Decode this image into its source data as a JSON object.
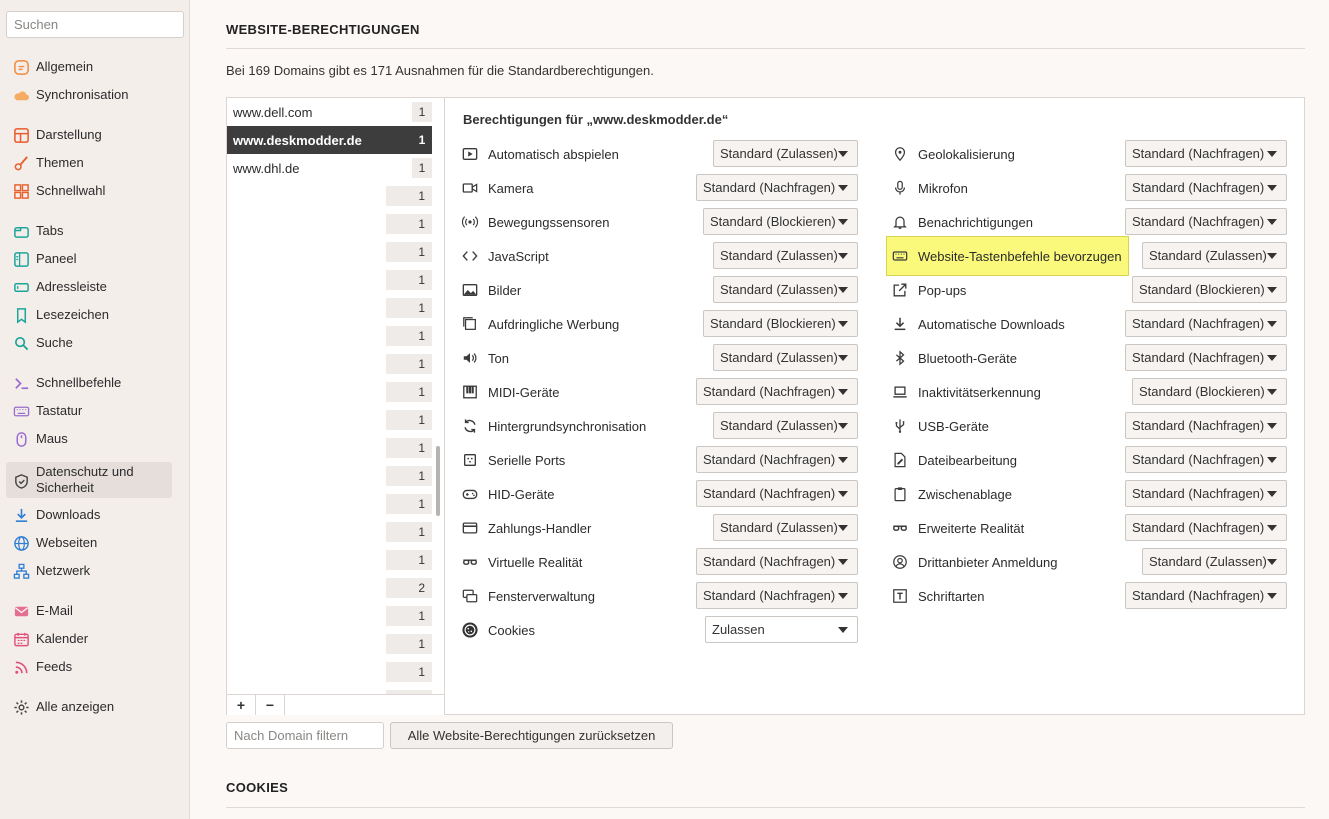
{
  "sidebar": {
    "search_placeholder": "Suchen",
    "items": [
      {
        "label": "Allgemein",
        "icon": "general-icon",
        "color": "#f08a3c"
      },
      {
        "label": "Synchronisation",
        "icon": "cloud-icon",
        "color": "#f5a04a"
      },
      {
        "label": "Darstellung",
        "icon": "appearance-icon",
        "color": "#e85a2c"
      },
      {
        "label": "Themen",
        "icon": "brush-icon",
        "color": "#e8602c"
      },
      {
        "label": "Schnellwahl",
        "icon": "speed-dial-icon",
        "color": "#e8602c"
      },
      {
        "label": "Tabs",
        "icon": "tabs-icon",
        "color": "#1ea59b"
      },
      {
        "label": "Paneel",
        "icon": "panel-icon",
        "color": "#1ea59b"
      },
      {
        "label": "Adressleiste",
        "icon": "address-bar-icon",
        "color": "#1ea59b"
      },
      {
        "label": "Lesezeichen",
        "icon": "bookmark-icon",
        "color": "#1ea59b"
      },
      {
        "label": "Suche",
        "icon": "search-icon",
        "color": "#1ea59b"
      },
      {
        "label": "Schnellbefehle",
        "icon": "quick-commands-icon",
        "color": "#9b6cd0"
      },
      {
        "label": "Tastatur",
        "icon": "keyboard-icon",
        "color": "#9b6cd0"
      },
      {
        "label": "Maus",
        "icon": "mouse-icon",
        "color": "#9b6cd0"
      },
      {
        "label": "Datenschutz und Sicherheit",
        "icon": "shield-icon",
        "color": "#444444"
      },
      {
        "label": "Downloads",
        "icon": "download-icon",
        "color": "#2f7fd3"
      },
      {
        "label": "Webseiten",
        "icon": "globe-icon",
        "color": "#2f7fd3"
      },
      {
        "label": "Netzwerk",
        "icon": "network-icon",
        "color": "#2f7fd3"
      },
      {
        "label": "E-Mail",
        "icon": "mail-icon",
        "color": "#e0507a"
      },
      {
        "label": "Kalender",
        "icon": "calendar-icon",
        "color": "#e0507a"
      },
      {
        "label": "Feeds",
        "icon": "feeds-icon",
        "color": "#e0507a"
      },
      {
        "label": "Alle anzeigen",
        "icon": "gear-icon",
        "color": "#444444"
      }
    ]
  },
  "main": {
    "section_title": "WEBSITE-BERECHTIGUNGEN",
    "summary": "Bei 169 Domains gibt es 171 Ausnahmen für die Standardberechtigungen.",
    "domains": [
      {
        "name": "www.dell.com",
        "count": "1"
      },
      {
        "name": "www.deskmodder.de",
        "count": "1"
      },
      {
        "name": "www.dhl.de",
        "count": "1"
      },
      {
        "name": "",
        "count": "1"
      },
      {
        "name": "",
        "count": "1"
      },
      {
        "name": "",
        "count": "1"
      },
      {
        "name": "",
        "count": "1"
      },
      {
        "name": "",
        "count": "1"
      },
      {
        "name": "",
        "count": "1"
      },
      {
        "name": "",
        "count": "1"
      },
      {
        "name": "",
        "count": "1"
      },
      {
        "name": "",
        "count": "1"
      },
      {
        "name": "",
        "count": "1"
      },
      {
        "name": "",
        "count": "1"
      },
      {
        "name": "",
        "count": "1"
      },
      {
        "name": "",
        "count": "1"
      },
      {
        "name": "",
        "count": "1"
      },
      {
        "name": "",
        "count": "2"
      },
      {
        "name": "",
        "count": "1"
      },
      {
        "name": "",
        "count": "1"
      },
      {
        "name": "",
        "count": "1"
      },
      {
        "name": "",
        "count": "1"
      }
    ],
    "add_label": "+",
    "remove_label": "−",
    "permissions_title": "Berechtigungen für „www.deskmodder.de“",
    "left_permissions": [
      {
        "label": "Automatisch abspielen",
        "icon": "autoplay-icon",
        "value": "Standard (Zulassen)"
      },
      {
        "label": "Kamera",
        "icon": "camera-icon",
        "value": "Standard (Nachfragen)"
      },
      {
        "label": "Bewegungssensoren",
        "icon": "motion-sensor-icon",
        "value": "Standard (Blockieren)"
      },
      {
        "label": "JavaScript",
        "icon": "code-icon",
        "value": "Standard (Zulassen)"
      },
      {
        "label": "Bilder",
        "icon": "image-icon",
        "value": "Standard (Zulassen)"
      },
      {
        "label": "Aufdringliche Werbung",
        "icon": "ads-icon",
        "value": "Standard (Blockieren)"
      },
      {
        "label": "Ton",
        "icon": "sound-icon",
        "value": "Standard (Zulassen)"
      },
      {
        "label": "MIDI-Geräte",
        "icon": "midi-icon",
        "value": "Standard (Nachfragen)"
      },
      {
        "label": "Hintergrundsynchronisation",
        "icon": "sync-icon",
        "value": "Standard (Zulassen)"
      },
      {
        "label": "Serielle Ports",
        "icon": "serial-port-icon",
        "value": "Standard (Nachfragen)"
      },
      {
        "label": "HID-Geräte",
        "icon": "gamepad-icon",
        "value": "Standard (Nachfragen)"
      },
      {
        "label": "Zahlungs-Handler",
        "icon": "credit-card-icon",
        "value": "Standard (Zulassen)"
      },
      {
        "label": "Virtuelle Realität",
        "icon": "vr-glasses-icon",
        "value": "Standard (Nachfragen)"
      },
      {
        "label": "Fensterverwaltung",
        "icon": "window-management-icon",
        "value": "Standard (Nachfragen)"
      },
      {
        "label": "Cookies",
        "icon": "cookie-icon",
        "value": "Zulassen"
      }
    ],
    "right_permissions": [
      {
        "label": "Geolokalisierung",
        "icon": "location-pin-icon",
        "value": "Standard (Nachfragen)"
      },
      {
        "label": "Mikrofon",
        "icon": "microphone-icon",
        "value": "Standard (Nachfragen)"
      },
      {
        "label": "Benachrichtigungen",
        "icon": "bell-icon",
        "value": "Standard (Nachfragen)"
      },
      {
        "label": "Website-Tastenbefehle bevorzugen",
        "icon": "keyboard-icon",
        "value": "Standard (Zulassen)"
      },
      {
        "label": "Pop-ups",
        "icon": "external-link-icon",
        "value": "Standard (Blockieren)"
      },
      {
        "label": "Automatische Downloads",
        "icon": "download-icon",
        "value": "Standard (Nachfragen)"
      },
      {
        "label": "Bluetooth-Geräte",
        "icon": "bluetooth-icon",
        "value": "Standard (Nachfragen)"
      },
      {
        "label": "Inaktivitätserkennung",
        "icon": "laptop-icon",
        "value": "Standard (Blockieren)"
      },
      {
        "label": "USB-Geräte",
        "icon": "usb-icon",
        "value": "Standard (Nachfragen)"
      },
      {
        "label": "Dateibearbeitung",
        "icon": "file-edit-icon",
        "value": "Standard (Nachfragen)"
      },
      {
        "label": "Zwischenablage",
        "icon": "clipboard-icon",
        "value": "Standard (Nachfragen)"
      },
      {
        "label": "Erweiterte Realität",
        "icon": "ar-glasses-icon",
        "value": "Standard (Nachfragen)"
      },
      {
        "label": "Drittanbieter Anmeldung",
        "icon": "user-circle-icon",
        "value": "Standard (Zulassen)"
      },
      {
        "label": "Schriftarten",
        "icon": "font-icon",
        "value": "Standard (Nachfragen)"
      }
    ],
    "filter_placeholder": "Nach Domain filtern",
    "reset_label": "Alle Website-Berechtigungen zurücksetzen",
    "cookies_title": "COOKIES",
    "highlight_color": "#fbf97c"
  }
}
